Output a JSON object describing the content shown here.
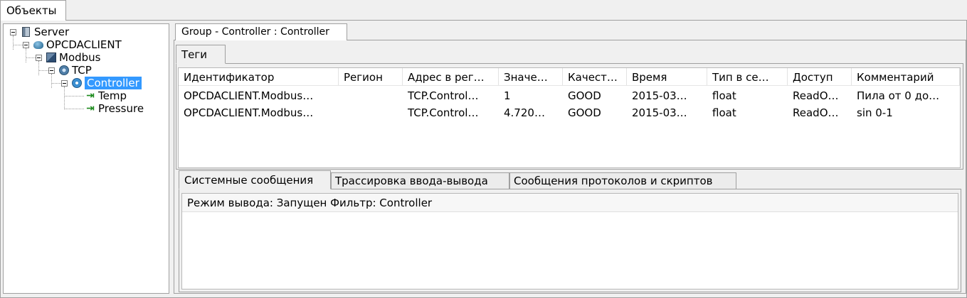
{
  "window": {
    "top_tab": "Объекты"
  },
  "tree": {
    "server": "Server",
    "client": "OPCDACLIENT",
    "modbus": "Modbus",
    "tcp": "TCP",
    "controller": "Controller",
    "tags": [
      "Temp",
      "Pressure"
    ]
  },
  "group_tab": "Group - Controller : Controller",
  "tags_tab": "Теги",
  "table": {
    "columns": [
      "Идентификатор",
      "Регион",
      "Адрес в рег…",
      "Значе…",
      "Качест…",
      "Время",
      "Тип в се…",
      "Доступ",
      "Комментарий"
    ],
    "rows": [
      [
        "OPCDACLIENT.Modbus…",
        "",
        "TCP.Control…",
        "1",
        "GOOD",
        "2015-03…",
        "float",
        "ReadO…",
        "Пила от 0 до…"
      ],
      [
        "OPCDACLIENT.Modbus…",
        "",
        "TCP.Control…",
        "4.720…",
        "GOOD",
        "2015-03…",
        "float",
        "ReadO…",
        "sin 0-1"
      ]
    ]
  },
  "bottom_tabs": [
    "Системные сообщения",
    "Трассировка ввода-вывода",
    "Сообщения протоколов и скриптов"
  ],
  "log": {
    "status_line": "Режим вывода: Запущен Фильтр: Controller"
  },
  "colors": {
    "selection": "#3399ff",
    "tag_icon": "#1c8a1c",
    "border": "#a0a0a0"
  }
}
